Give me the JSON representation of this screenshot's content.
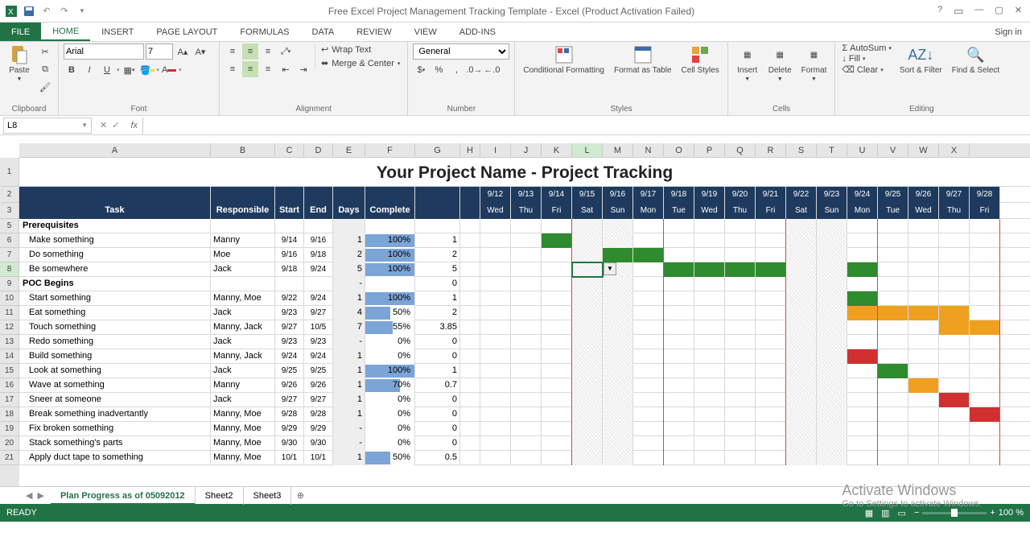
{
  "title": "Free Excel Project Management Tracking Template - Excel (Product Activation Failed)",
  "signin": "Sign in",
  "tabs": {
    "file": "FILE",
    "home": "HOME",
    "insert": "INSERT",
    "pagelayout": "PAGE LAYOUT",
    "formulas": "FORMULAS",
    "data": "DATA",
    "review": "REVIEW",
    "view": "VIEW",
    "addins": "ADD-INS"
  },
  "groups": {
    "clipboard": "Clipboard",
    "font": "Font",
    "alignment": "Alignment",
    "number": "Number",
    "styles": "Styles",
    "cells": "Cells",
    "editing": "Editing"
  },
  "font": {
    "name": "Arial",
    "size": "7"
  },
  "numberFormat": "General",
  "ribbonBtns": {
    "paste": "Paste",
    "wrap": "Wrap Text",
    "merge": "Merge & Center",
    "condfmt": "Conditional Formatting",
    "fmttable": "Format as Table",
    "cellstyles": "Cell Styles",
    "insert": "Insert",
    "delete": "Delete",
    "format": "Format",
    "autosum": "AutoSum",
    "fill": "Fill",
    "clear": "Clear",
    "sortfilter": "Sort & Filter",
    "findsel": "Find & Select"
  },
  "namebox": "L8",
  "projectTitle": "Your Project Name - Project Tracking",
  "colWidths": {
    "A": 238,
    "B": 80,
    "C": 36,
    "D": 36,
    "E": 40,
    "F": 62,
    "G": 56,
    "H": 25
  },
  "dayW": 38,
  "headers": {
    "task": "Task",
    "resp": "Responsible",
    "start": "Start",
    "end": "End",
    "days": "Days",
    "complete": "Complete"
  },
  "dates": [
    {
      "d": "9/12",
      "w": "Wed"
    },
    {
      "d": "9/13",
      "w": "Thu"
    },
    {
      "d": "9/14",
      "w": "Fri"
    },
    {
      "d": "9/15",
      "w": "Sat"
    },
    {
      "d": "9/16",
      "w": "Sun"
    },
    {
      "d": "9/17",
      "w": "Mon"
    },
    {
      "d": "9/18",
      "w": "Tue"
    },
    {
      "d": "9/19",
      "w": "Wed"
    },
    {
      "d": "9/20",
      "w": "Thu"
    },
    {
      "d": "9/21",
      "w": "Fri"
    },
    {
      "d": "9/22",
      "w": "Sat"
    },
    {
      "d": "9/23",
      "w": "Sun"
    },
    {
      "d": "9/24",
      "w": "Mon"
    },
    {
      "d": "9/25",
      "w": "Tue"
    },
    {
      "d": "9/26",
      "w": "Wed"
    },
    {
      "d": "9/27",
      "w": "Thu"
    },
    {
      "d": "9/28",
      "w": "Fri"
    }
  ],
  "rows": [
    {
      "n": 5,
      "section": true,
      "task": "Prerequisites"
    },
    {
      "n": 6,
      "task": "Make something",
      "resp": "Manny",
      "start": "9/14",
      "end": "9/16",
      "days": "1",
      "pct": 100,
      "g": "1",
      "gantt": [
        {
          "i": 2,
          "c": "gn"
        }
      ]
    },
    {
      "n": 7,
      "task": "Do something",
      "resp": "Moe",
      "start": "9/16",
      "end": "9/18",
      "days": "2",
      "pct": 100,
      "g": "2",
      "gantt": [
        {
          "i": 4,
          "c": "gn"
        },
        {
          "i": 5,
          "c": "gn"
        }
      ]
    },
    {
      "n": 8,
      "task": "Be somewhere",
      "resp": "Jack",
      "start": "9/18",
      "end": "9/24",
      "days": "5",
      "pct": 100,
      "g": "5",
      "sel": true,
      "gantt": [
        {
          "i": 6,
          "c": "gn"
        },
        {
          "i": 7,
          "c": "gn"
        },
        {
          "i": 8,
          "c": "gn"
        },
        {
          "i": 9,
          "c": "gn"
        },
        {
          "i": 12,
          "c": "gn"
        }
      ]
    },
    {
      "n": 9,
      "section": true,
      "task": "POC Begins",
      "days": "-",
      "g": "0"
    },
    {
      "n": 10,
      "task": "Start something",
      "resp": "Manny, Moe",
      "start": "9/22",
      "end": "9/24",
      "days": "1",
      "pct": 100,
      "g": "1",
      "gantt": [
        {
          "i": 12,
          "c": "gn"
        }
      ]
    },
    {
      "n": 11,
      "task": "Eat something",
      "resp": "Jack",
      "start": "9/23",
      "end": "9/27",
      "days": "4",
      "pct": 50,
      "g": "2",
      "gantt": [
        {
          "i": 12,
          "c": "or"
        },
        {
          "i": 13,
          "c": "or"
        },
        {
          "i": 14,
          "c": "or"
        },
        {
          "i": 15,
          "c": "or"
        }
      ]
    },
    {
      "n": 12,
      "task": "Touch something",
      "resp": "Manny, Jack",
      "start": "9/27",
      "end": "10/5",
      "days": "7",
      "pct": 55,
      "g": "3.85",
      "gantt": [
        {
          "i": 15,
          "c": "or"
        },
        {
          "i": 16,
          "c": "or"
        }
      ]
    },
    {
      "n": 13,
      "task": "Redo something",
      "resp": "Jack",
      "start": "9/23",
      "end": "9/23",
      "days": "-",
      "pct": 0,
      "g": "0"
    },
    {
      "n": 14,
      "task": "Build something",
      "resp": "Manny, Jack",
      "start": "9/24",
      "end": "9/24",
      "days": "1",
      "pct": 0,
      "g": "0",
      "gantt": [
        {
          "i": 12,
          "c": "rd"
        }
      ]
    },
    {
      "n": 15,
      "task": "Look at something",
      "resp": "Jack",
      "start": "9/25",
      "end": "9/25",
      "days": "1",
      "pct": 100,
      "g": "1",
      "gantt": [
        {
          "i": 13,
          "c": "gn"
        }
      ]
    },
    {
      "n": 16,
      "task": "Wave at something",
      "resp": "Manny",
      "start": "9/26",
      "end": "9/26",
      "days": "1",
      "pct": 70,
      "g": "0.7",
      "gantt": [
        {
          "i": 14,
          "c": "or"
        }
      ]
    },
    {
      "n": 17,
      "task": "Sneer at someone",
      "resp": "Jack",
      "start": "9/27",
      "end": "9/27",
      "days": "1",
      "pct": 0,
      "g": "0",
      "gantt": [
        {
          "i": 15,
          "c": "rd"
        }
      ]
    },
    {
      "n": 18,
      "task": "Break something inadvertantly",
      "resp": "Manny, Moe",
      "start": "9/28",
      "end": "9/28",
      "days": "1",
      "pct": 0,
      "g": "0",
      "gantt": [
        {
          "i": 16,
          "c": "rd"
        }
      ]
    },
    {
      "n": 19,
      "task": "Fix broken something",
      "resp": "Manny, Moe",
      "start": "9/29",
      "end": "9/29",
      "days": "-",
      "pct": 0,
      "g": "0"
    },
    {
      "n": 20,
      "task": "Stack something's parts",
      "resp": "Manny, Moe",
      "start": "9/30",
      "end": "9/30",
      "days": "-",
      "pct": 0,
      "g": "0"
    },
    {
      "n": 21,
      "task": "Apply duct tape to something",
      "resp": "Manny, Moe",
      "start": "10/1",
      "end": "10/1",
      "days": "1",
      "pct": 50,
      "g": "0.5"
    }
  ],
  "sheets": {
    "s1": "Plan Progress as of 05092012",
    "s2": "Sheet2",
    "s3": "Sheet3"
  },
  "status": {
    "ready": "READY",
    "zoom": "100 %"
  },
  "watermark": {
    "t": "Activate Windows",
    "s": "Go to Settings to activate Windows."
  }
}
